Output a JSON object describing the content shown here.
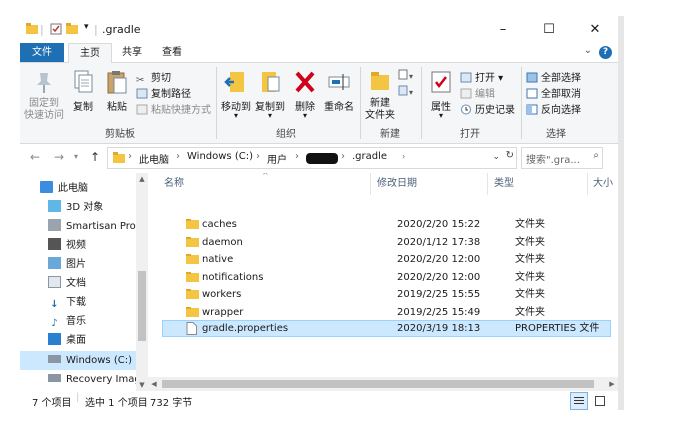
{
  "title": {
    "text": ".gradle",
    "minimize": "–",
    "maximize": "☐",
    "close": "✕"
  },
  "tabs": {
    "file": "文件",
    "home": "主页",
    "share": "共享",
    "view": "查看",
    "help": "?"
  },
  "ribbon": {
    "pin": "固定到\n快速访问",
    "copy": "复制",
    "paste": "粘贴",
    "cut": "剪切",
    "copy_path": "复制路径",
    "paste_shortcut": "粘贴快捷方式",
    "clipboard": "剪贴板",
    "move_to": "移动到",
    "copy_to": "复制到",
    "delete": "删除",
    "rename": "重命名",
    "organize": "组织",
    "new_folder": "新建\n文件夹",
    "new": "新建",
    "properties": "属性",
    "open": "打开",
    "edit": "编辑",
    "history": "历史记录",
    "open_group": "打开",
    "select_all": "全部选择",
    "select_none": "全部取消",
    "invert": "反向选择",
    "select": "选择"
  },
  "address": {
    "crumbs": [
      "此电脑",
      "Windows (C:)",
      "用户",
      "",
      ".gradle"
    ],
    "search_placeholder": "搜索\".gra..."
  },
  "nav": {
    "items": [
      {
        "label": "此电脑",
        "icon": "computer-icon"
      },
      {
        "label": "3D 对象",
        "icon": "3d-objects-icon"
      },
      {
        "label": "Smartisan Pro 2",
        "icon": "phone-icon"
      },
      {
        "label": "视频",
        "icon": "video-icon"
      },
      {
        "label": "图片",
        "icon": "pictures-icon"
      },
      {
        "label": "文档",
        "icon": "documents-icon"
      },
      {
        "label": "下载",
        "icon": "download-icon"
      },
      {
        "label": "音乐",
        "icon": "music-icon"
      },
      {
        "label": "桌面",
        "icon": "desktop-icon"
      },
      {
        "label": "Windows (C:)",
        "icon": "drive-icon"
      },
      {
        "label": "Recovery Imag",
        "icon": "drive-icon"
      }
    ]
  },
  "list": {
    "columns": [
      "名称",
      "修改日期",
      "类型",
      "大小"
    ],
    "rows": [
      {
        "name": "caches",
        "date": "2020/2/20 15:22",
        "type": "文件夹",
        "kind": "folder"
      },
      {
        "name": "daemon",
        "date": "2020/1/12 17:38",
        "type": "文件夹",
        "kind": "folder"
      },
      {
        "name": "native",
        "date": "2020/2/20 12:00",
        "type": "文件夹",
        "kind": "folder"
      },
      {
        "name": "notifications",
        "date": "2020/2/20 12:00",
        "type": "文件夹",
        "kind": "folder"
      },
      {
        "name": "workers",
        "date": "2019/2/25 15:55",
        "type": "文件夹",
        "kind": "folder"
      },
      {
        "name": "wrapper",
        "date": "2019/2/25 15:49",
        "type": "文件夹",
        "kind": "folder"
      },
      {
        "name": "gradle.properties",
        "date": "2020/3/19 18:13",
        "type": "PROPERTIES 文件",
        "kind": "file"
      }
    ]
  },
  "status": {
    "count": "7 个项目",
    "selected": "选中 1 个项目",
    "size": "732 字节"
  },
  "colors": {
    "accent": "#1f6fb5",
    "folder": "#f4c542",
    "selection": "#cce8ff"
  }
}
